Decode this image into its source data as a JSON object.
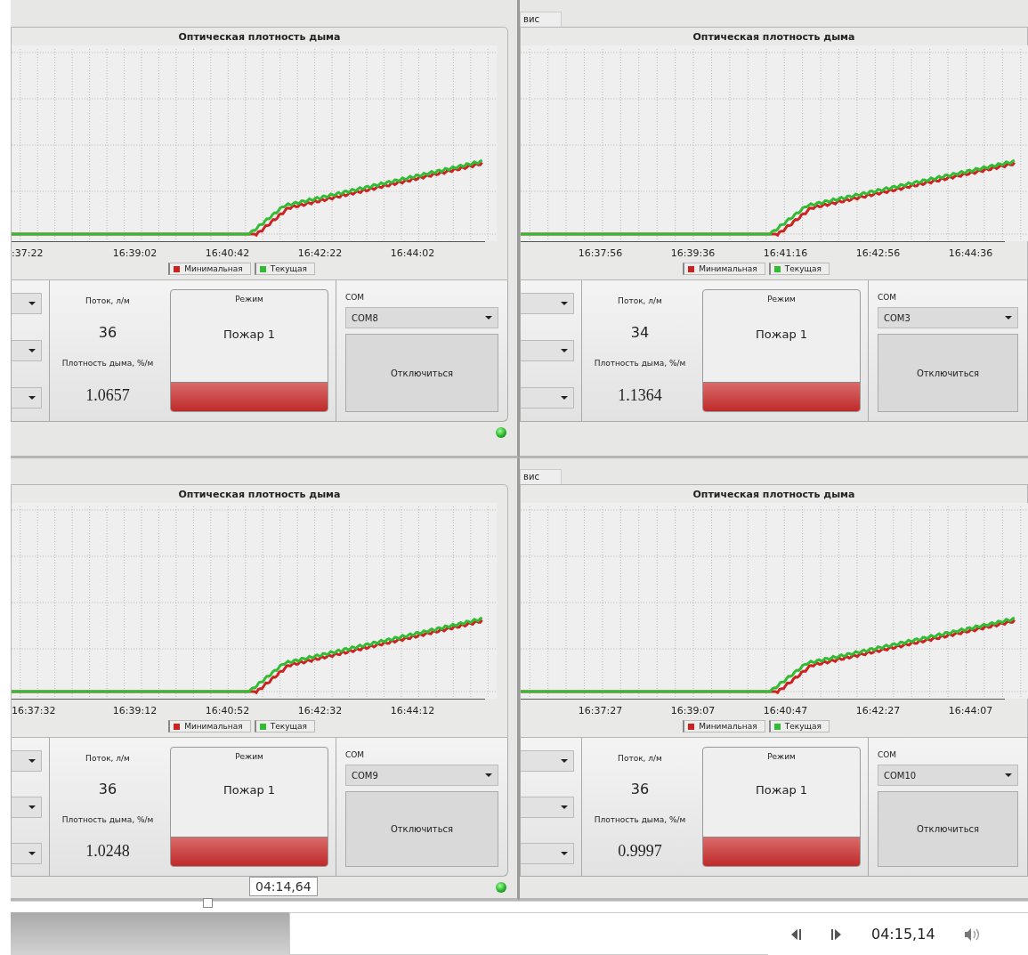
{
  "panes": [
    {
      "title": "Оптическая плотность дыма",
      "x_ticks": [
        ":37:22",
        "16:39:02",
        "16:40:42",
        "16:42:22",
        "16:44:02"
      ],
      "legend": [
        {
          "label": "Минимальная",
          "color": "#cc2222"
        },
        {
          "label": "Текущая",
          "color": "#33bb33"
        }
      ],
      "flow_label": "Поток, л/м",
      "flow_value": "36",
      "density_label": "Плотность дыма, %/м",
      "density_value": "1.0657",
      "mode_label": "Режим",
      "mode_value": "Пожар 1",
      "com_label": "COM",
      "com_value": "COM8",
      "disconnect_button": "Отключиться",
      "status_led": true
    },
    {
      "tab_label": "вис",
      "title": "Оптическая плотность дыма",
      "x_ticks": [
        "16:37:56",
        "16:39:36",
        "16:41:16",
        "16:42:56",
        "16:44:36"
      ],
      "legend": [
        {
          "label": "Минимальная",
          "color": "#cc2222"
        },
        {
          "label": "Текущая",
          "color": "#33bb33"
        }
      ],
      "flow_label": "Поток, л/м",
      "flow_value": "34",
      "density_label": "Плотность дыма, %/м",
      "density_value": "1.1364",
      "mode_label": "Режим",
      "mode_value": "Пожар 1",
      "com_label": "COM",
      "com_value": "COM3",
      "disconnect_button": "Отключиться"
    },
    {
      "title": "Оптическая плотность дыма",
      "x_ticks": [
        "16:37:32",
        "16:39:12",
        "16:40:52",
        "16:42:32",
        "16:44:12"
      ],
      "legend": [
        {
          "label": "Минимальная",
          "color": "#cc2222"
        },
        {
          "label": "Текущая",
          "color": "#33bb33"
        }
      ],
      "flow_label": "Поток, л/м",
      "flow_value": "36",
      "density_label": "Плотность дыма, %/м",
      "density_value": "1.0248",
      "mode_label": "Режим",
      "mode_value": "Пожар 1",
      "com_label": "COM",
      "com_value": "COM9",
      "disconnect_button": "Отключиться",
      "status_led": true
    },
    {
      "tab_label": "вис",
      "title": "Оптическая плотность дыма",
      "x_ticks": [
        "16:37:27",
        "16:39:07",
        "16:40:47",
        "16:42:27",
        "16:44:07"
      ],
      "legend": [
        {
          "label": "Минимальная",
          "color": "#cc2222"
        },
        {
          "label": "Текущая",
          "color": "#33bb33"
        }
      ],
      "flow_label": "Поток, л/м",
      "flow_value": "36",
      "density_label": "Плотность дыма, %/м",
      "density_value": "0.9997",
      "mode_label": "Режим",
      "mode_value": "Пожар 1",
      "com_label": "COM",
      "com_value": "COM10",
      "disconnect_button": "Отключиться"
    }
  ],
  "player": {
    "hover_time": "04:14,64",
    "current_time": "04:15,14"
  }
}
